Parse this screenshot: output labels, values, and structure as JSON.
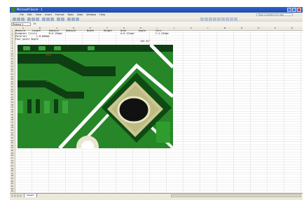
{
  "app": {
    "title": "Microsoft Excel - 1"
  },
  "menu": {
    "items": [
      "File",
      "Edit",
      "View",
      "Insert",
      "Format",
      "Tools",
      "Data",
      "Window",
      "Help"
    ],
    "help_placeholder": "Type a question for help"
  },
  "formula_bar": {
    "name_box": "Picture 1",
    "fx": "fx"
  },
  "columns": [
    "A",
    "B",
    "C",
    "D",
    "E",
    "F",
    "G",
    "H",
    "I",
    "J",
    "K",
    "L",
    "M",
    "N",
    "O",
    "P",
    "Q"
  ],
  "rows": [
    "1",
    "2",
    "3",
    "4",
    "5",
    "6",
    "7",
    "8",
    "9",
    "10",
    "11",
    "12",
    "13",
    "14",
    "15",
    "16",
    "17",
    "18",
    "19",
    "20",
    "21",
    "22",
    "23",
    "24",
    "25",
    "26",
    "27",
    "28",
    "29",
    "30",
    "31",
    "32",
    "33",
    "34",
    "35",
    "36",
    "37",
    "38",
    "39",
    "40",
    "41",
    "42",
    "43",
    "44",
    "45",
    "46",
    "47",
    "48",
    "49",
    "50",
    "51",
    "52",
    "53",
    "54",
    "55",
    "56",
    "57",
    "58",
    "59",
    "60",
    "61",
    "62",
    "63",
    "64"
  ],
  "cells": {
    "r1": [
      "Measure",
      "Length",
      "Radius1",
      "Radius2",
      "Width",
      "Height",
      "Area",
      "Angle",
      "Circ."
    ],
    "r2": [
      "Diameter Circle",
      "",
      "R:0.194mm",
      "",
      "",
      "",
      "A:0.121mm²",
      "",
      "C:1.234mm"
    ],
    "r3": [
      "Parallel",
      "L:0.609mm"
    ],
    "r4": [
      "Four point Angle",
      "",
      "",
      "",
      "",
      "",
      "",
      "135.32°"
    ]
  },
  "sheet_tabs": [
    "Sheet1"
  ],
  "colors": {
    "pcb_green": "#2e8f2e",
    "pcb_dark": "#0d3f12",
    "pad_gold": "#c9c58e",
    "trace_white": "#ffffff"
  }
}
